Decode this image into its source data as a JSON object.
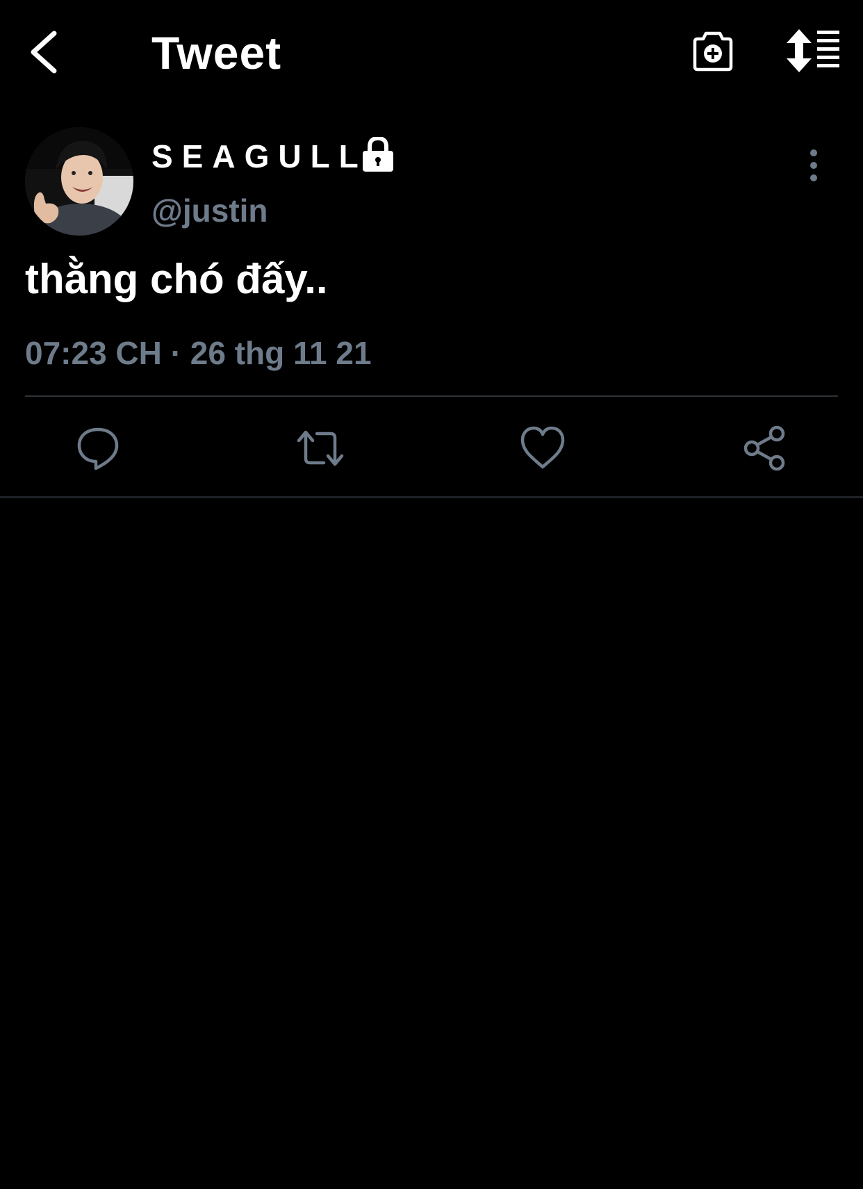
{
  "header": {
    "title": "Tweet",
    "back_icon": "chevron-left-icon",
    "camera_icon": "camera-add-icon",
    "sort_icon": "sort-list-icon"
  },
  "tweet": {
    "display_name": "SEAGULL",
    "handle": "@justin",
    "text": "thằng chó đấy..",
    "timestamp": "07:23 CH · 26 thg 11 21",
    "protected": true
  },
  "actions": [
    "reply-icon",
    "retweet-icon",
    "like-icon",
    "share-icon"
  ],
  "colors": {
    "background": "#000000",
    "text": "#ffffff",
    "muted": "#6e7b8a",
    "divider": "#2f3336"
  }
}
